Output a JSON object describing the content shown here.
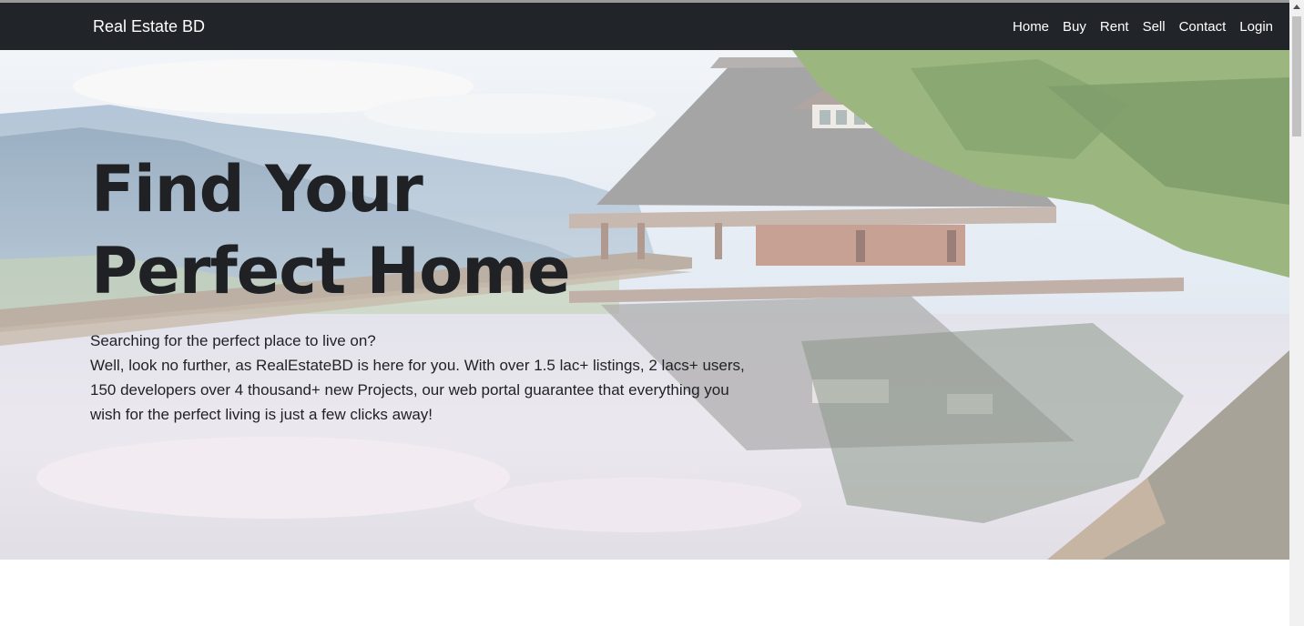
{
  "navbar": {
    "brand": "Real Estate BD",
    "links": [
      "Home",
      "Buy",
      "Rent",
      "Sell",
      "Contact",
      "Login"
    ]
  },
  "hero": {
    "title_line1": "Find Your",
    "title_line2": "Perfect Home",
    "subtitle": "Searching for the perfect place to live on?",
    "description": "Well, look no further, as RealEstateBD is here for you. With over 1.5 lac+ listings, 2 lacs+ users, 150 developers over 4 thousand+ new Projects, our web portal guarantee that everything you wish for the perfect living is just a few clicks away!"
  },
  "colors": {
    "navbar_bg": "#212529",
    "nav_text": "#ffffff",
    "hero_text": "#1f2124"
  }
}
